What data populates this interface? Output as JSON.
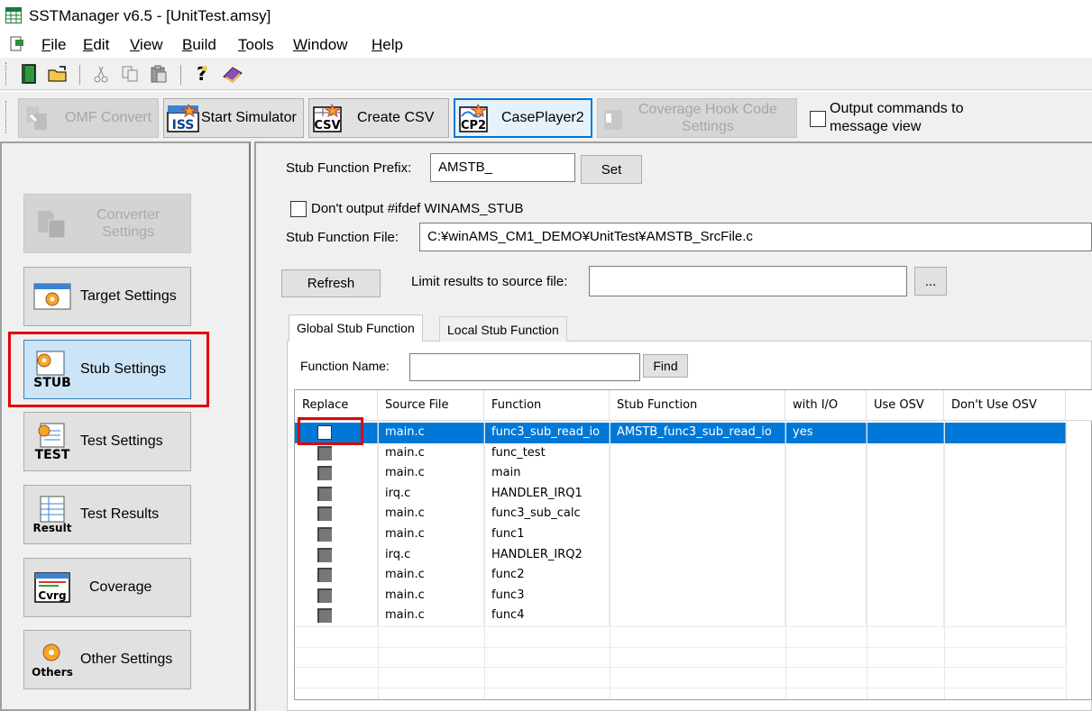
{
  "window": {
    "title": "SSTManager v6.5 - [UnitTest.amsy]"
  },
  "menu": [
    {
      "pre": "",
      "ul": "F",
      "post": "ile"
    },
    {
      "pre": "",
      "ul": "E",
      "post": "dit"
    },
    {
      "pre": "",
      "ul": "V",
      "post": "iew"
    },
    {
      "pre": "",
      "ul": "B",
      "post": "uild"
    },
    {
      "pre": "",
      "ul": "T",
      "post": "ools"
    },
    {
      "pre": "",
      "ul": "W",
      "post": "indow"
    },
    {
      "pre": "",
      "ul": "H",
      "post": "elp"
    }
  ],
  "toolbar2": {
    "omf_convert": "OMF Convert",
    "iss_icon": "ISS",
    "start_simulator": "Start Simulator",
    "csv_icon": "CSV",
    "create_csv": "Create CSV",
    "cp2_icon": "CP2",
    "caseplayer2": "CasePlayer2",
    "coverage_hook_1": "Coverage Hook Code",
    "coverage_hook_2": "Settings",
    "output_commands_1": "Output commands to",
    "output_commands_2": "message view"
  },
  "sidebar": {
    "converter_1": "Converter",
    "converter_2": "Settings",
    "target": "Target Settings",
    "stub": "Stub Settings",
    "stub_icon": "STUB",
    "test": "Test Settings",
    "test_icon": "TEST",
    "results": "Test Results",
    "results_icon": "Result",
    "coverage": "Coverage",
    "coverage_icon": "Cvrg",
    "other": "Other Settings",
    "other_icon": "Others"
  },
  "stub": {
    "prefix_label": "Stub Function Prefix:",
    "prefix_value": "AMSTB_",
    "set_button": "Set",
    "dont_output_label": "Don't output #ifdef WINAMS_STUB",
    "file_label": "Stub Function File:",
    "file_value": "C:¥winAMS_CM1_DEMO¥UnitTest¥AMSTB_SrcFile.c",
    "refresh_button": "Refresh",
    "limit_label": "Limit results to source file:",
    "limit_value": "",
    "browse_button": "...",
    "tab_global": "Global Stub Function",
    "tab_local": "Local Stub Function",
    "function_name_label": "Function Name:",
    "function_name_value": "",
    "find_button": "Find"
  },
  "grid": {
    "headers": [
      "Replace",
      "Source File",
      "Function",
      "Stub Function",
      "with I/O",
      "Use OSV",
      "Don't Use OSV"
    ],
    "rows": [
      {
        "source": "main.c",
        "function": "func3_sub_read_io",
        "stub": "AMSTB_func3_sub_read_io",
        "io": "yes",
        "use_osv": "",
        "dont_use_osv": ""
      },
      {
        "source": "main.c",
        "function": "func_test",
        "stub": "",
        "io": "",
        "use_osv": "",
        "dont_use_osv": ""
      },
      {
        "source": "main.c",
        "function": "main",
        "stub": "",
        "io": "",
        "use_osv": "",
        "dont_use_osv": ""
      },
      {
        "source": "irq.c",
        "function": "HANDLER_IRQ1",
        "stub": "",
        "io": "",
        "use_osv": "",
        "dont_use_osv": ""
      },
      {
        "source": "main.c",
        "function": "func3_sub_calc",
        "stub": "",
        "io": "",
        "use_osv": "",
        "dont_use_osv": ""
      },
      {
        "source": "main.c",
        "function": "func1",
        "stub": "",
        "io": "",
        "use_osv": "",
        "dont_use_osv": ""
      },
      {
        "source": "irq.c",
        "function": "HANDLER_IRQ2",
        "stub": "",
        "io": "",
        "use_osv": "",
        "dont_use_osv": ""
      },
      {
        "source": "main.c",
        "function": "func2",
        "stub": "",
        "io": "",
        "use_osv": "",
        "dont_use_osv": ""
      },
      {
        "source": "main.c",
        "function": "func3",
        "stub": "",
        "io": "",
        "use_osv": "",
        "dont_use_osv": ""
      },
      {
        "source": "main.c",
        "function": "func4",
        "stub": "",
        "io": "",
        "use_osv": "",
        "dont_use_osv": ""
      }
    ]
  },
  "colors": {
    "selection": "#0078d7",
    "highlight_box": "#e00000"
  }
}
